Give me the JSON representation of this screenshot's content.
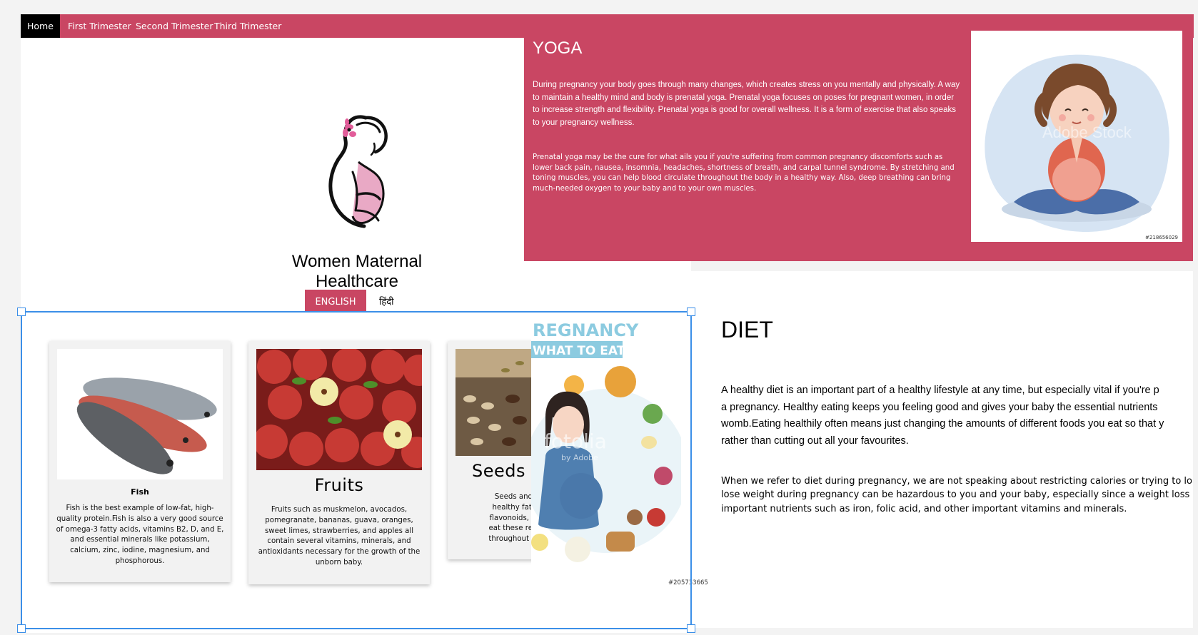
{
  "nav": {
    "items": [
      "Home",
      "First Trimester",
      "Second Trimester",
      "Third Trimester"
    ],
    "active": "Home"
  },
  "brand": {
    "title": "Women Maternal Healthcare",
    "languages": [
      "ENGLISH",
      "हिंदी"
    ]
  },
  "yoga": {
    "title": "YOGA",
    "paragraph1": "During pregnancy your body goes through many changes, which creates stress on you mentally and physically. A way to maintain a healthy mind and body is prenatal yoga. Prenatal yoga focuses on poses for pregnant women, in order to increase strength and flexibility. Prenatal yoga is good for overall wellness. It is a form of exercise that also speaks to your pregnancy wellness.",
    "paragraph2": "Prenatal yoga may be the cure for what ails you if you're suffering from common pregnancy discomforts such as lower back pain, nausea, insomnia, headaches, shortness of breath, and carpal tunnel syndrome. By stretching and toning muscles, you can help blood circulate throughout the body in a healthy way. Also, deep breathing can bring much-needed oxygen to your baby and to your own muscles.",
    "image_id": "#218656029",
    "watermark": "Adobe Stock"
  },
  "diet": {
    "title": "DIET",
    "paragraph1": "A healthy diet is an important part of a healthy lifestyle at any time, but especially vital if you're p\na pregnancy. Healthy eating keeps you feeling good and gives your baby the essential nutrients\nwomb.Eating healthily often means just changing the amounts of different foods you eat so that y\nrather than cutting out all your favourites.",
    "paragraph2": "When we refer to diet during pregnancy, we are not speaking about restricting calories or trying to lo\nlose weight during pregnancy can be hazardous to you and your baby, especially since a weight loss\nimportant nutrients such as iron, folic acid, and other important vitamins and minerals."
  },
  "cards": [
    {
      "title": "Fish",
      "text": "Fish is the best example of low-fat, high-\nquality protein.Fish is also a very good source\nof omega-3 fatty acids, vitamins B2, D, and E,\nand essential minerals like potassium,\ncalcium, zinc, iodine, magnesium, and\nphosphorous."
    },
    {
      "title": "Fruits",
      "text": "Fruits such as muskmelon, avocados,\npomegranate, bananas, guava, oranges,\nsweet limes, strawberries, and apples all\ncontain several vitamins, minerals, and\nantioxidants necessary for the growth of the\nunborn baby."
    },
    {
      "title": "Seeds a",
      "text": "Seeds and nuts ar\nhealthy fats, vitami\nflavonoids, and dieta\neat these regularly in\nthroughout your preg"
    }
  ],
  "infographic": {
    "title_line1": "REGNANCY",
    "title_line2": "WHAT TO EAT",
    "watermark": "fotolia",
    "watermark_sub": "by Adobe",
    "image_id": "#205733665"
  },
  "colors": {
    "accent": "#c94663",
    "selection": "#3b8fe8",
    "nav_active": "#000000"
  }
}
